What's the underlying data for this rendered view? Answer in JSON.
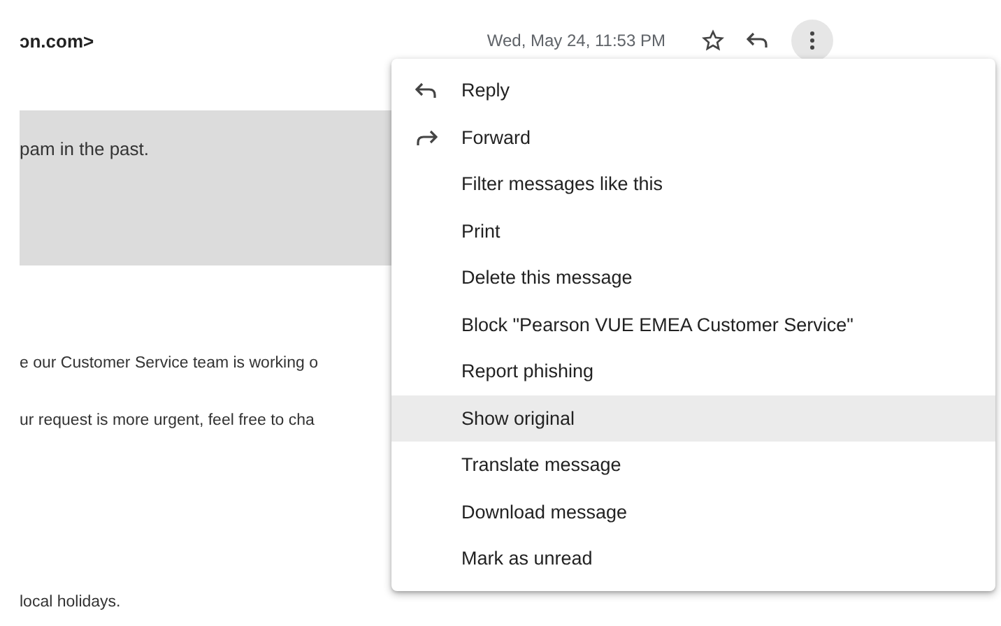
{
  "header": {
    "sender": "ɔn.com>",
    "date": "Wed, May 24, 11:53 PM",
    "starred": false
  },
  "banner": {
    "text": "pam in the past."
  },
  "body": [
    "e our Customer Service team is working o",
    "ur request is more urgent, feel free to cha",
    "local holidays."
  ],
  "menu": {
    "items": [
      {
        "label": "Reply",
        "kind": "reply",
        "selected": false
      },
      {
        "label": "Forward",
        "kind": "forward",
        "selected": false
      },
      {
        "label": "Filter messages like this",
        "kind": "text",
        "selected": false
      },
      {
        "label": "Print",
        "kind": "text",
        "selected": false
      },
      {
        "label": "Delete this message",
        "kind": "text",
        "selected": false
      },
      {
        "label": "Block \"Pearson VUE EMEA Customer Service\"",
        "kind": "text",
        "selected": false
      },
      {
        "label": "Report phishing",
        "kind": "text",
        "selected": false
      },
      {
        "label": "Show original",
        "kind": "text",
        "selected": true
      },
      {
        "label": "Translate message",
        "kind": "text",
        "selected": false
      },
      {
        "label": "Download message",
        "kind": "text",
        "selected": false
      },
      {
        "label": "Mark as unread",
        "kind": "text",
        "selected": false
      }
    ]
  }
}
